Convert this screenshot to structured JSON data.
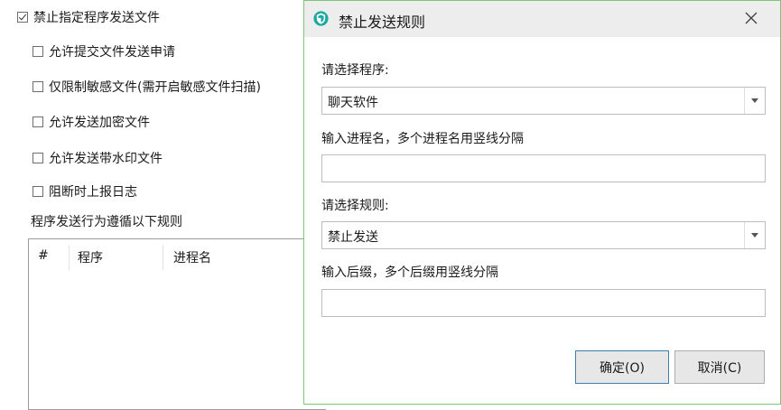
{
  "options": {
    "main": "禁止指定程序发送文件",
    "allow_submit": "允许提交文件发送申请",
    "limit_sensitive": "仅限制敏感文件(需开启敏感文件扫描)",
    "allow_encrypted": "允许发送加密文件",
    "allow_watermark": "允许发送带水印文件",
    "report_log": "阻断时上报日志"
  },
  "rules_label": "程序发送行为遵循以下规则",
  "table": {
    "headers": [
      "#",
      "程序",
      "进程名"
    ]
  },
  "dialog": {
    "title": "禁止发送规则",
    "program_label": "请选择程序:",
    "program_value": "聊天软件",
    "process_label": "输入进程名，多个进程名用竖线分隔",
    "process_value": "",
    "rule_label": "请选择规则:",
    "rule_value": "禁止发送",
    "suffix_label": "输入后缀，多个后缀用竖线分隔",
    "suffix_value": "",
    "ok_label": "确定(O)",
    "cancel_label": "取消(C)"
  },
  "colors": {
    "dialog_border": "#7cc576",
    "title_icon": "#1aa8a0"
  }
}
